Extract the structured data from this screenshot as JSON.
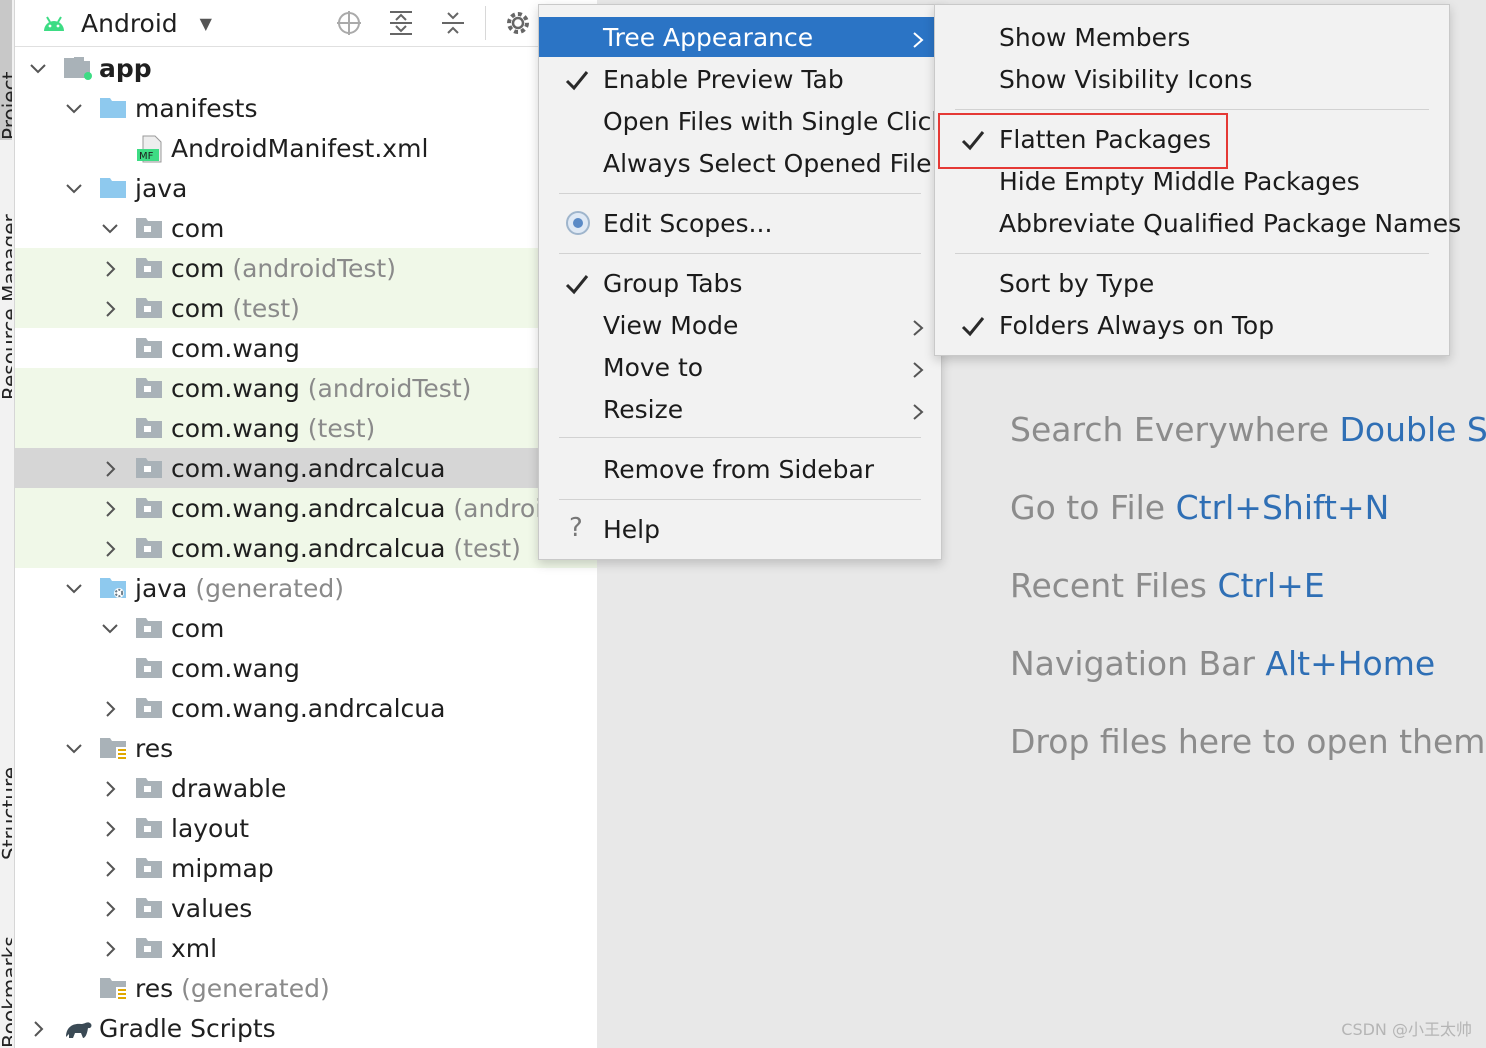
{
  "left_strip": {
    "tabs": [
      "Project",
      "Resource Manager",
      "Structure",
      "Bookmarks"
    ]
  },
  "toolbar": {
    "view_label": "Android",
    "icons": [
      "android-icon",
      "chevron-down-icon",
      "locate-icon",
      "expand-all-icon",
      "collapse-all-icon",
      "gear-icon"
    ]
  },
  "tree": [
    {
      "name": "app",
      "sub": "",
      "icon": "module-folder-icon",
      "expanded": true,
      "bold": true
    },
    {
      "name": "manifests",
      "sub": "",
      "icon": "folder-blue-icon",
      "expanded": true
    },
    {
      "name": "AndroidManifest.xml",
      "sub": "",
      "icon": "manifest-file-icon"
    },
    {
      "name": "java",
      "sub": "",
      "icon": "folder-blue-icon",
      "expanded": true
    },
    {
      "name": "com",
      "sub": "",
      "icon": "package-icon",
      "expanded": true
    },
    {
      "name": "com",
      "sub": "(androidTest)",
      "icon": "package-icon",
      "expanded": false
    },
    {
      "name": "com",
      "sub": "(test)",
      "icon": "package-icon",
      "expanded": false
    },
    {
      "name": "com.wang",
      "sub": "",
      "icon": "package-icon"
    },
    {
      "name": "com.wang",
      "sub": "(androidTest)",
      "icon": "package-icon"
    },
    {
      "name": "com.wang",
      "sub": "(test)",
      "icon": "package-icon"
    },
    {
      "name": "com.wang.andrcalcua",
      "sub": "",
      "icon": "package-icon",
      "expanded": false
    },
    {
      "name": "com.wang.andrcalcua",
      "sub": "(androidT",
      "icon": "package-icon",
      "expanded": false
    },
    {
      "name": "com.wang.andrcalcua",
      "sub": "(test)",
      "icon": "package-icon",
      "expanded": false
    },
    {
      "name": "java",
      "sub": "(generated)",
      "icon": "generated-folder-icon",
      "expanded": true
    },
    {
      "name": "com",
      "sub": "",
      "icon": "package-icon",
      "expanded": true
    },
    {
      "name": "com.wang",
      "sub": "",
      "icon": "package-icon"
    },
    {
      "name": "com.wang.andrcalcua",
      "sub": "",
      "icon": "package-icon",
      "expanded": false
    },
    {
      "name": "res",
      "sub": "",
      "icon": "res-folder-icon",
      "expanded": true
    },
    {
      "name": "drawable",
      "sub": "",
      "icon": "package-icon",
      "expanded": false
    },
    {
      "name": "layout",
      "sub": "",
      "icon": "package-icon",
      "expanded": false
    },
    {
      "name": "mipmap",
      "sub": "",
      "icon": "package-icon",
      "expanded": false
    },
    {
      "name": "values",
      "sub": "",
      "icon": "package-icon",
      "expanded": false
    },
    {
      "name": "xml",
      "sub": "",
      "icon": "package-icon",
      "expanded": false
    },
    {
      "name": "res",
      "sub": "(generated)",
      "icon": "res-folder-icon"
    },
    {
      "name": "Gradle Scripts",
      "sub": "",
      "icon": "gradle-icon",
      "expanded": false
    }
  ],
  "main_menu": {
    "items": [
      {
        "label": "Tree Appearance",
        "submenu": true,
        "active": true
      },
      {
        "label": "Enable Preview Tab",
        "checked": true
      },
      {
        "label": "Open Files with Single Click"
      },
      {
        "label": "Always Select Opened File"
      },
      {
        "label": "Edit Scopes...",
        "icon": "radio-scope-icon"
      },
      {
        "label": "Group Tabs",
        "checked": true
      },
      {
        "label": "View Mode",
        "submenu": true
      },
      {
        "label": "Move to",
        "submenu": true
      },
      {
        "label": "Resize",
        "submenu": true
      },
      {
        "label": "Remove from Sidebar"
      },
      {
        "label": "Help",
        "icon": "help-icon"
      }
    ]
  },
  "sub_menu": {
    "items": [
      {
        "label": "Show Members"
      },
      {
        "label": "Show Visibility Icons"
      },
      {
        "label": "Flatten Packages",
        "checked": true,
        "highlighted": true
      },
      {
        "label": "Hide Empty Middle Packages"
      },
      {
        "label": "Abbreviate Qualified Package Names"
      },
      {
        "label": "Sort by Type"
      },
      {
        "label": "Folders Always on Top",
        "checked": true
      }
    ]
  },
  "editor_hints": [
    {
      "text": "Search Everywhere",
      "key": "Double Shif"
    },
    {
      "text": "Go to File",
      "key": "Ctrl+Shift+N"
    },
    {
      "text": "Recent Files",
      "key": "Ctrl+E"
    },
    {
      "text": "Navigation Bar",
      "key": "Alt+Home"
    },
    {
      "text": "Drop files here to open them",
      "key": ""
    }
  ],
  "watermark": "CSDN @小王太帅",
  "colors": {
    "menu_active": "#2b74c5",
    "highlight_border": "#e53935",
    "hint_key": "#2f6fb5",
    "tree_green_row": "#f0f8e8"
  }
}
